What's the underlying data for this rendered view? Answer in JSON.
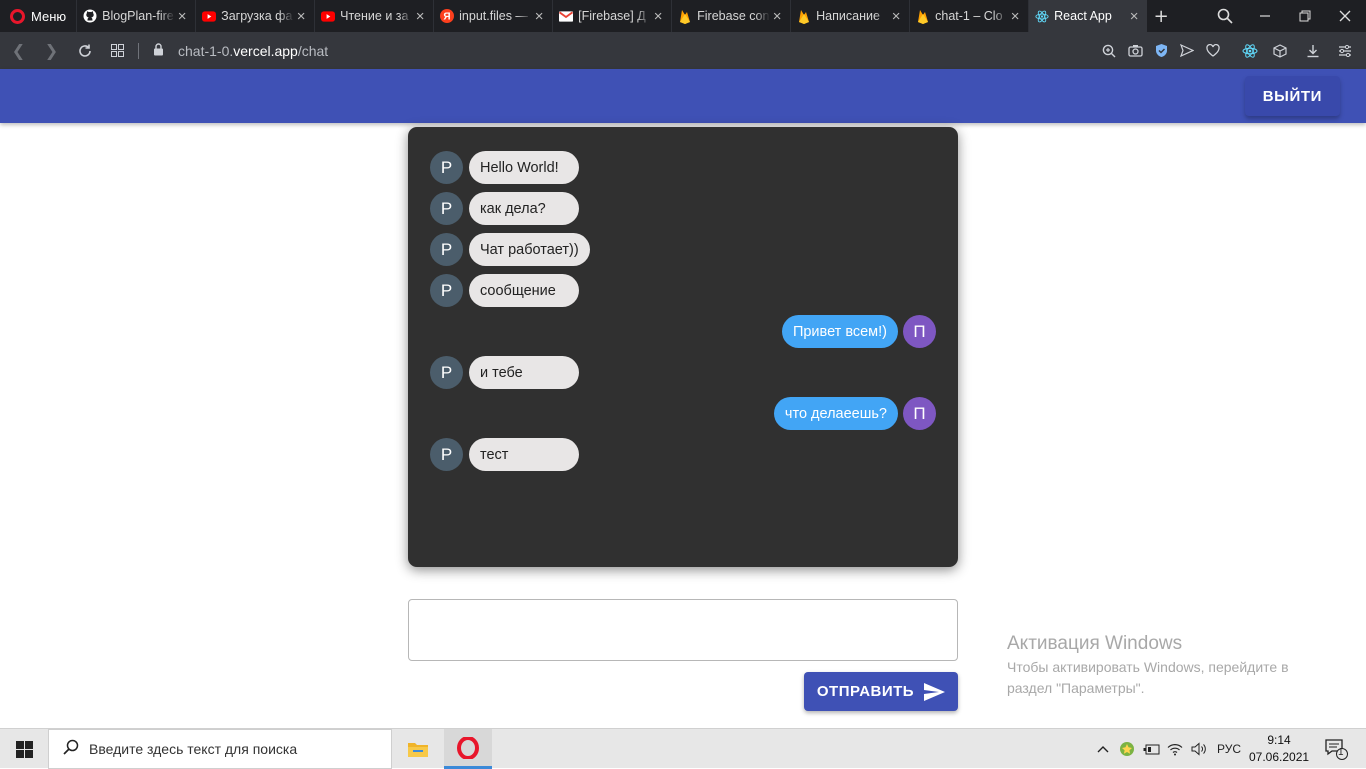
{
  "browser": {
    "menu_label": "Меню",
    "tabs": [
      {
        "label": "BlogPlan-fire",
        "icon": "github-icon"
      },
      {
        "label": "Загрузка фа",
        "icon": "youtube-icon"
      },
      {
        "label": "Чтение и за",
        "icon": "youtube-icon"
      },
      {
        "label": "input.files —",
        "icon": "yandex-icon"
      },
      {
        "label": "[Firebase] Д",
        "icon": "gmail-icon"
      },
      {
        "label": "Firebase con",
        "icon": "firebase-icon"
      },
      {
        "label": "Написание",
        "icon": "firebase-icon"
      },
      {
        "label": "chat-1 – Clo",
        "icon": "firebase-icon"
      },
      {
        "label": "React App",
        "icon": "react-icon",
        "active": true
      }
    ],
    "url_prefix": "chat-1-0.",
    "url_host": "vercel.app",
    "url_path": "/chat"
  },
  "header": {
    "logout_label": "ВЫЙТИ",
    "accent": "#3f51b5"
  },
  "chat": {
    "messages": [
      {
        "text": "Hello World!",
        "avatar": "P",
        "direction": "in"
      },
      {
        "text": "как дела?",
        "avatar": "P",
        "direction": "in"
      },
      {
        "text": "Чат работает))",
        "avatar": "P",
        "direction": "in"
      },
      {
        "text": "сообщение",
        "avatar": "P",
        "direction": "in"
      },
      {
        "text": "Привет всем!)",
        "avatar": "П",
        "direction": "out"
      },
      {
        "text": "и тебе",
        "avatar": "P",
        "direction": "in"
      },
      {
        "text": "что делаеешь?",
        "avatar": "П",
        "direction": "out"
      },
      {
        "text": "тест",
        "avatar": "P",
        "direction": "in"
      }
    ],
    "input_value": "",
    "send_label": "ОТПРАВИТЬ"
  },
  "watermark": {
    "title": "Активация Windows",
    "subtitle": "Чтобы активировать Windows, перейдите в раздел \"Параметры\"."
  },
  "taskbar": {
    "search_placeholder": "Введите здесь текст для поиска",
    "language": "РУС",
    "time": "9:14",
    "date": "07.06.2021",
    "notification_count": "1"
  }
}
